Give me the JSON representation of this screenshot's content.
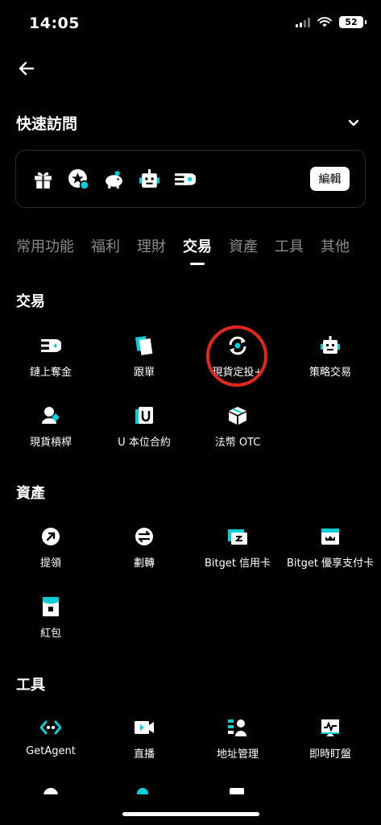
{
  "status": {
    "time": "14:05",
    "battery": "52"
  },
  "quick_access": {
    "title": "快速訪問",
    "edit_label": "編輯",
    "icons": [
      "gift-icon",
      "star-badge-icon",
      "piggy-bank-icon",
      "robot-icon",
      "ticket-icon"
    ]
  },
  "tabs": [
    {
      "label": "常用功能",
      "active": false
    },
    {
      "label": "福利",
      "active": false
    },
    {
      "label": "理財",
      "active": false
    },
    {
      "label": "交易",
      "active": true
    },
    {
      "label": "資產",
      "active": false
    },
    {
      "label": "工具",
      "active": false
    },
    {
      "label": "其他",
      "active": false
    }
  ],
  "sections": {
    "trade": {
      "title": "交易",
      "items": [
        {
          "label": "鏈上奪金",
          "icon": "onchain-icon"
        },
        {
          "label": "跟單",
          "icon": "copy-trade-icon"
        },
        {
          "label": "現貨定投+",
          "icon": "recurring-buy-icon"
        },
        {
          "label": "策略交易",
          "icon": "robot-icon"
        },
        {
          "label": "現貨槓桿",
          "icon": "margin-icon"
        },
        {
          "label": "U 本位合約",
          "icon": "usdt-futures-icon"
        },
        {
          "label": "法幣 OTC",
          "icon": "otc-cube-icon"
        }
      ]
    },
    "assets": {
      "title": "資產",
      "items": [
        {
          "label": "提領",
          "icon": "withdraw-icon"
        },
        {
          "label": "劃轉",
          "icon": "transfer-icon"
        },
        {
          "label": "Bitget 信用卡",
          "icon": "credit-card-icon"
        },
        {
          "label": "Bitget 優享支付卡",
          "icon": "pay-card-icon"
        },
        {
          "label": "紅包",
          "icon": "red-packet-icon"
        }
      ]
    },
    "tools": {
      "title": "工具",
      "items": [
        {
          "label": "GetAgent",
          "icon": "getagent-icon"
        },
        {
          "label": "直播",
          "icon": "live-stream-icon"
        },
        {
          "label": "地址管理",
          "icon": "address-book-icon"
        },
        {
          "label": "即時盯盤",
          "icon": "monitor-chart-icon"
        }
      ]
    }
  },
  "colors": {
    "accent": "#00d1d9",
    "highlight": "#e0291c",
    "background": "#000000"
  }
}
